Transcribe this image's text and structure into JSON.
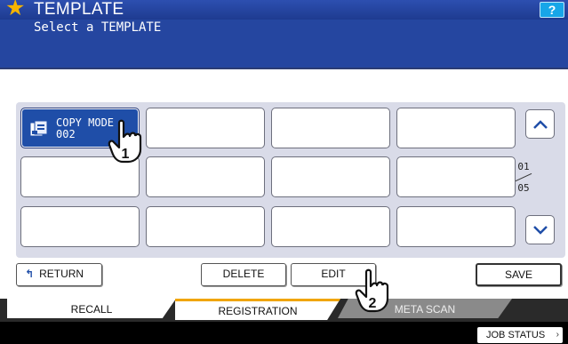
{
  "header": {
    "title": "TEMPLATE",
    "subtitle": "Select a TEMPLATE",
    "help_label": "?"
  },
  "grid": {
    "filled_cell": {
      "line1": "COPY MODE",
      "line2": "002"
    },
    "page": {
      "current": "01",
      "total": "05"
    },
    "up_label": "^",
    "down_label": "v"
  },
  "buttons": {
    "return": "RETURN",
    "delete": "DELETE",
    "edit": "EDIT",
    "save": "SAVE"
  },
  "tabs": {
    "recall": "RECALL",
    "registration": "REGISTRATION",
    "meta_scan": "META SCAN"
  },
  "status": {
    "job_status": "JOB STATUS"
  },
  "callouts": {
    "step1": "1",
    "step2": "2"
  },
  "colors": {
    "header_blue": "#2546a0",
    "accent_orange": "#f0a500",
    "selected_blue": "#1f4ea8"
  }
}
